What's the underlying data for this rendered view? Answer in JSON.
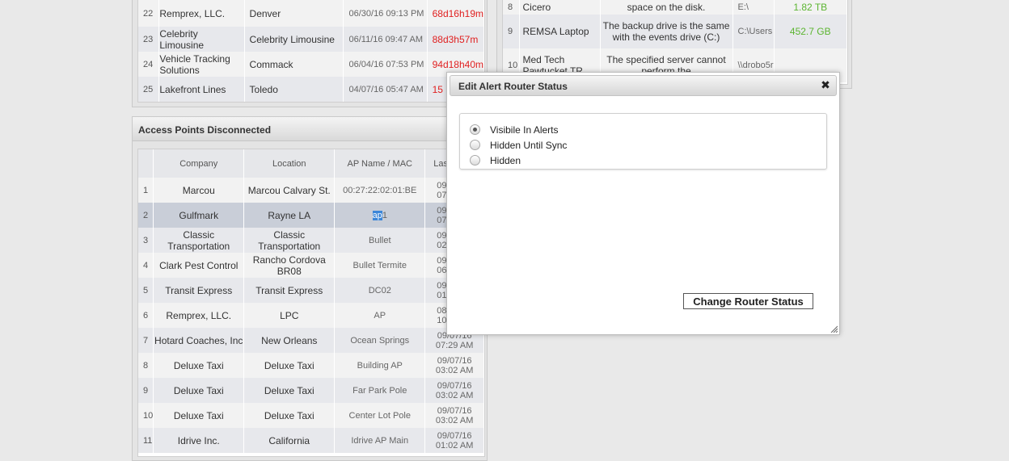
{
  "top_left_rows": [
    {
      "num": "22",
      "company": "Remprex, LLC.",
      "location": "Denver",
      "time": "06/30/16 09:13 PM",
      "dur": "68d16h19m"
    },
    {
      "num": "23",
      "company": "Celebrity Limousine",
      "location": "Celebrity Limousine",
      "time": "06/11/16 09:47 AM",
      "dur": "88d3h57m"
    },
    {
      "num": "24",
      "company": "Vehicle Tracking Solutions",
      "location": "Commack",
      "time": "06/04/16 07:53 PM",
      "dur": "94d18h40m"
    },
    {
      "num": "25",
      "company": "Lakefront Lines",
      "location": "Toledo",
      "time": "04/07/16 05:47 AM",
      "dur": "15"
    }
  ],
  "top_right_rows": [
    {
      "num": "8",
      "name": "Cicero",
      "message": "space on the disk.",
      "path": "E:\\",
      "size": "1.82 TB"
    },
    {
      "num": "9",
      "name": "REMSA Laptop",
      "message": "The backup drive is the same with the events drive (C:)",
      "path": "C:\\Users",
      "size": "452.7 GB"
    },
    {
      "num": "10",
      "name": "Med Tech Pawtucket TR",
      "message": "The specified server cannot perform the",
      "path": "\\\\drobo5r",
      "size": ""
    }
  ],
  "ap_panel": {
    "title": "Access Points Disconnected",
    "headers": [
      "",
      "Company",
      "Location",
      "AP Name / MAC",
      "Las"
    ],
    "rows": [
      {
        "num": "1",
        "company": "Marcou",
        "location": "Marcou Calvary St.",
        "ap": "00:27:22:02:01:BE",
        "last1": "09",
        "last2": "07"
      },
      {
        "num": "2",
        "company": "Gulfmark",
        "location": "Rayne LA",
        "ap_sel": "ap",
        "ap_rest": "1",
        "last1": "09",
        "last2": "07"
      },
      {
        "num": "3",
        "company": "Classic Transportation",
        "location": "Classic Transportation",
        "ap": "Bullet",
        "last1": "09",
        "last2": "02"
      },
      {
        "num": "4",
        "company": "Clark Pest Control",
        "location": "Rancho Cordova BR08",
        "ap": "Bullet Termite",
        "last1": "09",
        "last2": "06"
      },
      {
        "num": "5",
        "company": "Transit Express",
        "location": "Transit Express",
        "ap": "DC02",
        "last1": "09",
        "last2": "01"
      },
      {
        "num": "6",
        "company": "Remprex, LLC.",
        "location": "LPC",
        "ap": "AP",
        "last1": "08",
        "last2": "10"
      },
      {
        "num": "7",
        "company": "Hotard Coaches, Inc",
        "location": "New Orleans",
        "ap": "Ocean Springs",
        "last1": "09/07/16",
        "last2": "07:29 AM"
      },
      {
        "num": "8",
        "company": "Deluxe Taxi",
        "location": "Deluxe Taxi",
        "ap": "Building AP",
        "last1": "09/07/16",
        "last2": "03:02 AM"
      },
      {
        "num": "9",
        "company": "Deluxe Taxi",
        "location": "Deluxe Taxi",
        "ap": "Far Park Pole",
        "last1": "09/07/16",
        "last2": "03:02 AM"
      },
      {
        "num": "10",
        "company": "Deluxe Taxi",
        "location": "Deluxe Taxi",
        "ap": "Center Lot Pole",
        "last1": "09/07/16",
        "last2": "03:02 AM"
      },
      {
        "num": "11",
        "company": "Idrive Inc.",
        "location": "California",
        "ap": "Idrive AP Main",
        "last1": "09/07/16",
        "last2": "01:02 AM"
      }
    ]
  },
  "dialog": {
    "title": "Edit Alert Router Status",
    "close_icon": "close-icon",
    "options": [
      "Visibile In Alerts",
      "Hidden Until Sync",
      "Hidden"
    ],
    "selected_index": 0,
    "button_label": "Change Router Status"
  },
  "colors": {
    "duration_red": "#e02020",
    "size_green": "#5cb531",
    "selection_blue": "#3b86d8"
  }
}
